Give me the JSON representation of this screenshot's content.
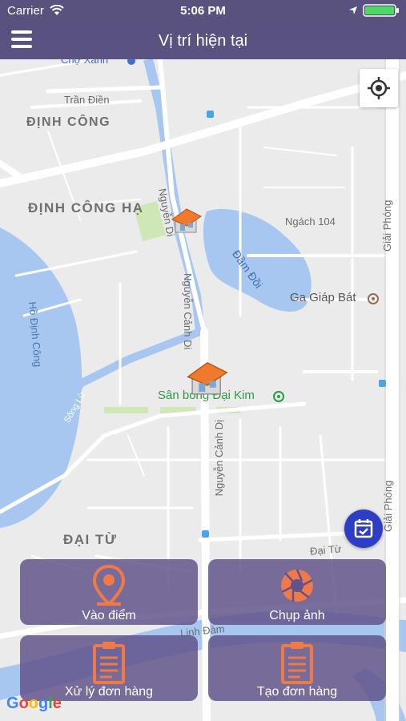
{
  "status_bar": {
    "carrier": "Carrier",
    "time": "5:06 PM"
  },
  "nav": {
    "title": "Vị trí hiện tại"
  },
  "map": {
    "labels": {
      "cho_xanh": "Chợ Xanh",
      "tran_dien": "Trần Điền",
      "dinh_cong": "ĐỊNH CÔNG",
      "dinh_cong_ha": "ĐỊNH CÔNG HẠ",
      "nguyen_di_top": "Nguyễn Di",
      "ngach_104": "Ngách 104",
      "giai_phong_top": "Giải Phóng",
      "dam_doi": "Đầm Đồi",
      "ga_giap_bat": "Ga Giáp Bát",
      "nguyen_canh_di_mid": "Nguyễn Cảnh Di",
      "ho_dinh_cong": "Hồ Định Công",
      "song_lu": "Sông Lừ",
      "san_bong": "Sân bóng Đại Kim",
      "nguyen_canh_di_low": "Nguyễn Cảnh Dị",
      "giai_phong_bottom": "Giải Phóng",
      "dai_tu_district": "ĐẠI TỪ",
      "dai_tu_road": "Đại Từ",
      "linh_dam": "Linh Đàm"
    },
    "google_logo": "Google"
  },
  "actions": [
    {
      "label": "Vào điểm",
      "icon": "map-pin-icon"
    },
    {
      "label": "Chụp ảnh",
      "icon": "camera-aperture-icon"
    },
    {
      "label": "Xử lý đơn hàng",
      "icon": "clipboard-icon"
    },
    {
      "label": "Tạo đơn hàng",
      "icon": "clipboard-icon"
    }
  ],
  "colors": {
    "header": "#59527f",
    "tile": "#60528a",
    "accent_orange": "#e9733f",
    "fab": "#2d3ec5",
    "water": "#a7c7f0"
  }
}
